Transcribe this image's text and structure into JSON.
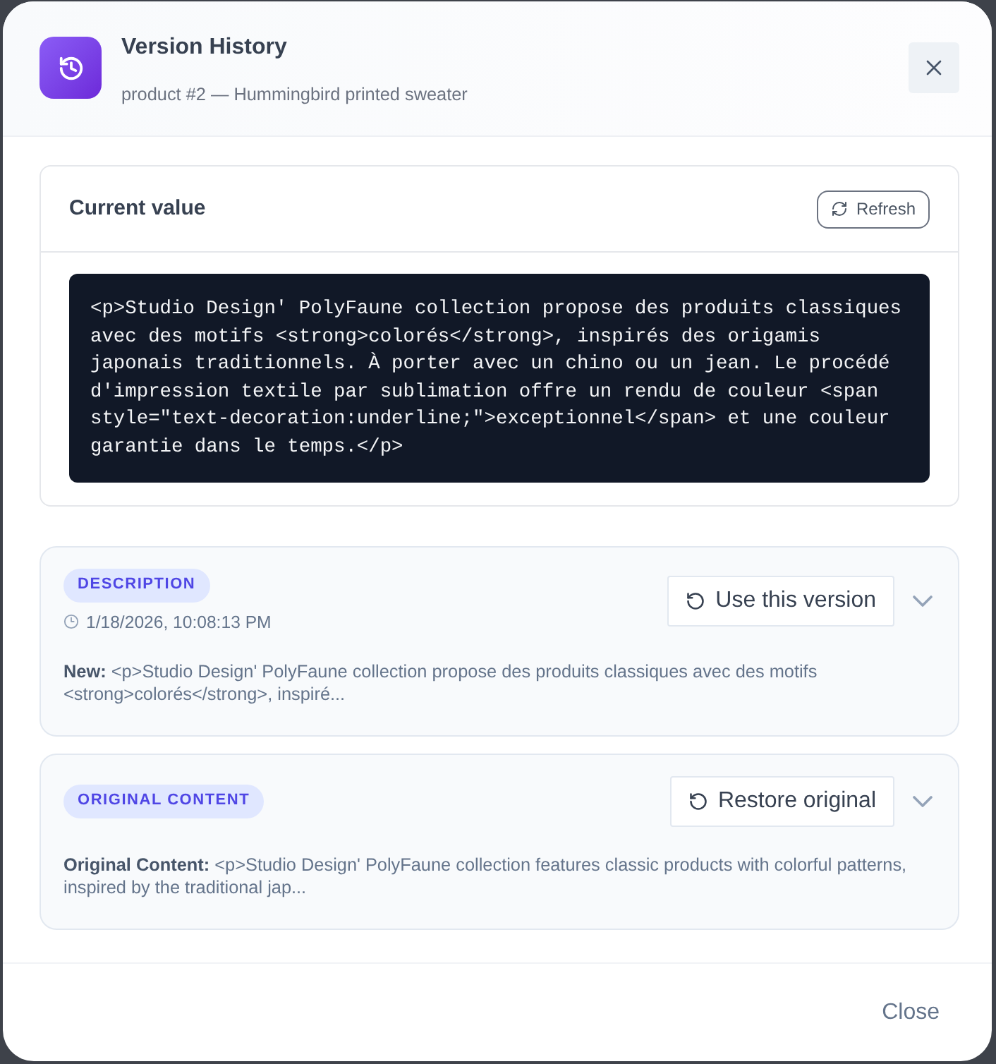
{
  "dialog": {
    "title": "Version History",
    "subtitle": "product #2 — Hummingbird printed sweater",
    "close_label": "Close"
  },
  "current_value": {
    "heading": "Current value",
    "refresh_button": "Refresh",
    "code": "<p>Studio Design' PolyFaune collection propose des produits classiques avec des motifs <strong>colorés</strong>, inspirés des origamis japonais traditionnels. À porter avec un chino ou un jean. Le procédé d'impression textile par sublimation offre un rendu de couleur <span style=\"text-decoration:underline;\">exceptionnel</span> et une couleur garantie dans le temps.</p>"
  },
  "versions": [
    {
      "badge": "DESCRIPTION",
      "timestamp": "1/18/2026, 10:08:13 PM",
      "action": "Use this version",
      "expanded": false,
      "summary": "**New:** <p>Studio Design' PolyFaune collection propose des produits classiques avec des motifs <strong>colorés</strong>, inspiré..."
    },
    {
      "badge": "ORIGINAL CONTENT",
      "action": "Restore original",
      "expanded": false,
      "summary": "**Original Content:** <p>Studio Design' PolyFaune collection features classic products with colorful patterns, inspired by the traditional jap..."
    }
  ]
}
